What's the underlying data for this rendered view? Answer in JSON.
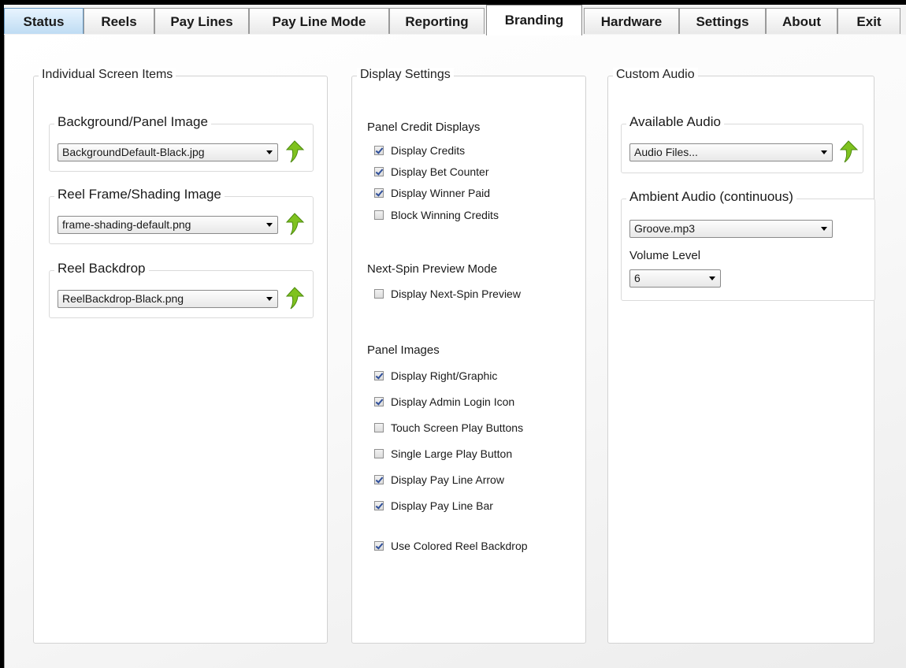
{
  "tabs": [
    {
      "label": "Status",
      "active": false
    },
    {
      "label": "Reels",
      "active": false
    },
    {
      "label": "Pay Lines",
      "active": false
    },
    {
      "label": "Pay Line Mode",
      "active": false
    },
    {
      "label": "Reporting",
      "active": false
    },
    {
      "label": "Branding",
      "active": true
    },
    {
      "label": "Hardware",
      "active": false
    },
    {
      "label": "Settings",
      "active": false
    },
    {
      "label": "About",
      "active": false
    },
    {
      "label": "Exit",
      "active": false
    }
  ],
  "left_panel": {
    "title": "Individual Screen Items",
    "groups": [
      {
        "title": "Background/Panel Image",
        "value": "BackgroundDefault-Black.jpg"
      },
      {
        "title": "Reel Frame/Shading Image",
        "value": "frame-shading-default.png"
      },
      {
        "title": "Reel Backdrop",
        "value": "ReelBackdrop-Black.png"
      }
    ]
  },
  "middle_panel": {
    "title": "Display Settings",
    "sections": [
      {
        "label": "Panel Credit Displays"
      },
      {
        "label": "Next-Spin Preview Mode"
      },
      {
        "label": "Panel Images"
      }
    ],
    "checkboxes": [
      {
        "label": "Display Credits",
        "checked": true
      },
      {
        "label": "Display Bet Counter",
        "checked": true
      },
      {
        "label": "Display Winner Paid",
        "checked": true
      },
      {
        "label": "Block Winning Credits",
        "checked": false
      },
      {
        "label": "Display Next-Spin Preview",
        "checked": false
      },
      {
        "label": "Display Right/Graphic",
        "checked": true
      },
      {
        "label": "Display Admin Login Icon",
        "checked": true
      },
      {
        "label": "Touch Screen Play Buttons",
        "checked": false
      },
      {
        "label": "Single Large Play Button",
        "checked": false
      },
      {
        "label": "Display Pay Line Arrow",
        "checked": true
      },
      {
        "label": "Display Pay Line Bar",
        "checked": true
      },
      {
        "label": "Use Colored Reel Backdrop",
        "checked": true
      }
    ]
  },
  "right_panel": {
    "title": "Custom Audio",
    "available_audio": {
      "title": "Available Audio",
      "value": "Audio Files..."
    },
    "ambient_audio": {
      "title": "Ambient Audio (continuous)",
      "value": "Groove.mp3",
      "volume_label": "Volume Level",
      "volume_value": "6"
    }
  },
  "colors": {
    "accent_arrow": "#7fc21f",
    "status_tab": "#bfdcf3",
    "check": "#2f4f9a"
  }
}
